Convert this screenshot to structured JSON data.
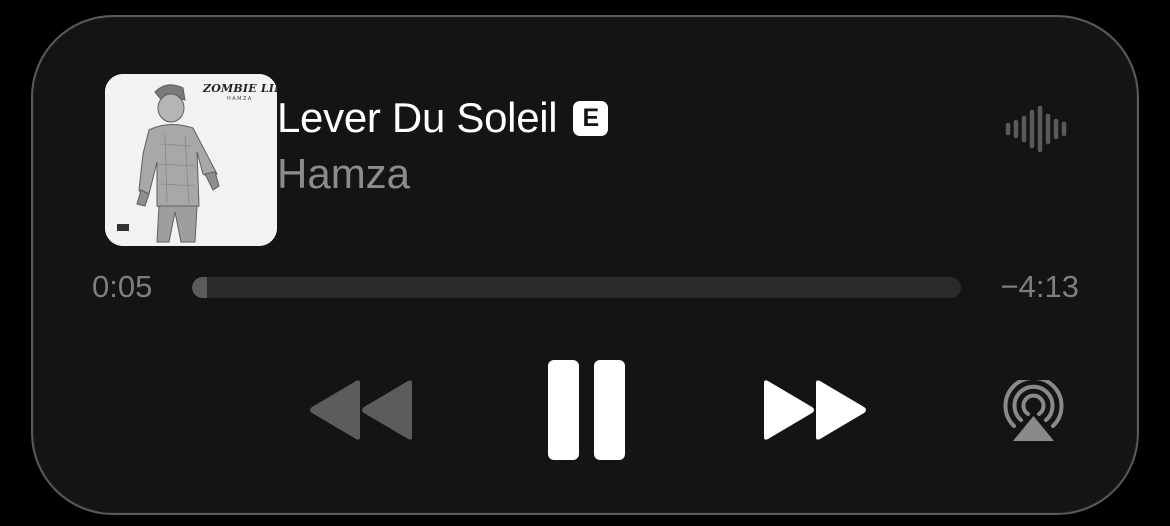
{
  "now_playing": {
    "title": "Lever Du Soleil",
    "explicit_badge": "E",
    "artist": "Hamza",
    "artwork": {
      "label": "ZOMBIE LIFE",
      "sublabel": "HAMZA"
    }
  },
  "progress": {
    "elapsed": "0:05",
    "remaining": "−4:13",
    "fraction": 0.02
  },
  "controls": {
    "rewind_icon": "rewind-icon",
    "pause_icon": "pause-icon",
    "forward_icon": "fast-forward-icon",
    "airplay_icon": "airplay-icon",
    "waveform_icon": "waveform-icon"
  },
  "colors": {
    "background": "#141414",
    "title": "#ffffff",
    "artist": "#8c8c8c",
    "time": "#7e7e7e",
    "track": "#2a2a2a",
    "track_fill": "#5b5b5b",
    "rewind_disabled": "#5c5c5c",
    "airplay": "#8a8a8a"
  }
}
